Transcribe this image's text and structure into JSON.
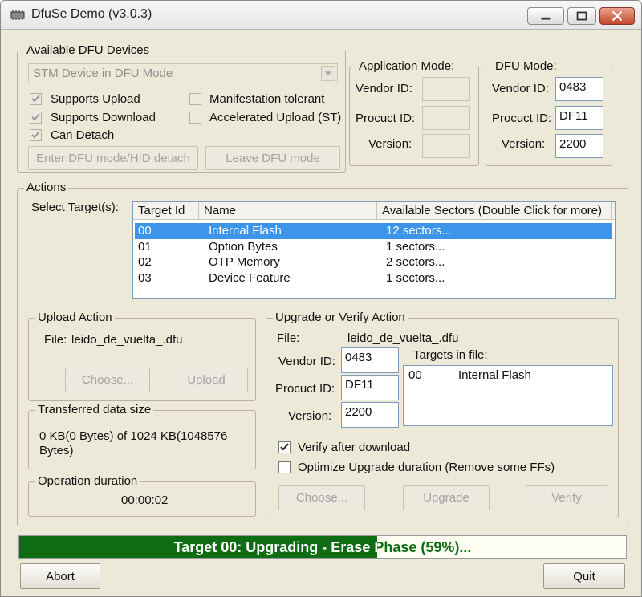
{
  "window": {
    "title": "DfuSe Demo (v3.0.3)"
  },
  "devices": {
    "legend": "Available DFU Devices",
    "selected_device": "STM Device in DFU Mode",
    "supports_upload": {
      "label": "Supports Upload",
      "checked": true
    },
    "supports_download": {
      "label": "Supports Download",
      "checked": true
    },
    "can_detach": {
      "label": "Can Detach",
      "checked": true
    },
    "manifestation_tolerant": {
      "label": "Manifestation tolerant",
      "checked": false
    },
    "accelerated_upload": {
      "label": "Accelerated Upload (ST)",
      "checked": false
    },
    "enter_dfu_label": "Enter DFU mode/HID detach",
    "leave_dfu_label": "Leave DFU mode"
  },
  "app_mode": {
    "legend": "Application Mode:",
    "vendor_label": "Vendor ID:",
    "vendor_value": "",
    "product_label": "Procuct ID:",
    "product_value": "",
    "version_label": "Version:",
    "version_value": ""
  },
  "dfu_mode": {
    "legend": "DFU Mode:",
    "vendor_label": "Vendor ID:",
    "vendor_value": "0483",
    "product_label": "Procuct ID:",
    "product_value": "DF11",
    "version_label": "Version:",
    "version_value": "2200"
  },
  "actions": {
    "legend": "Actions",
    "select_targets_label": "Select Target(s):",
    "columns": [
      "Target Id",
      "Name",
      "Available Sectors (Double Click for more)"
    ],
    "rows": [
      {
        "id": "00",
        "name": "Internal Flash",
        "sectors": "12 sectors...",
        "selected": true
      },
      {
        "id": "01",
        "name": "Option Bytes",
        "sectors": "1 sectors...",
        "selected": false
      },
      {
        "id": "02",
        "name": "OTP Memory",
        "sectors": "2 sectors...",
        "selected": false
      },
      {
        "id": "03",
        "name": "Device Feature",
        "sectors": "1 sectors...",
        "selected": false
      }
    ]
  },
  "upload": {
    "legend": "Upload Action",
    "file_label": "File:",
    "file_name": "leido_de_vuelta_.dfu",
    "choose_label": "Choose...",
    "upload_label": "Upload"
  },
  "transfer": {
    "legend": "Transferred data size",
    "line1": "0 KB(0 Bytes) of 1024 KB(1048576",
    "line2": "Bytes)"
  },
  "duration": {
    "legend": "Operation duration",
    "value": "00:00:02"
  },
  "upgrade": {
    "legend": "Upgrade or Verify Action",
    "file_label": "File:",
    "file_name": "leido_de_vuelta_.dfu",
    "vendor_label": "Vendor ID:",
    "vendor_value": "0483",
    "product_label": "Procuct ID:",
    "product_value": "DF11",
    "version_label": "Version:",
    "version_value": "2200",
    "targets_label": "Targets in file:",
    "targets": [
      {
        "id": "00",
        "name": "Internal Flash"
      }
    ],
    "verify_after": {
      "label": "Verify after download",
      "checked": true
    },
    "optimize": {
      "label": "Optimize Upgrade duration (Remove some FFs)",
      "checked": false
    },
    "choose_label": "Choose...",
    "upgrade_label": "Upgrade",
    "verify_label": "Verify"
  },
  "progress": {
    "text": "Target 00: Upgrading - Erase Phase (59%)...",
    "percent": 59,
    "fill_color": "#0e6d12"
  },
  "footer": {
    "abort_label": "Abort",
    "quit_label": "Quit"
  }
}
